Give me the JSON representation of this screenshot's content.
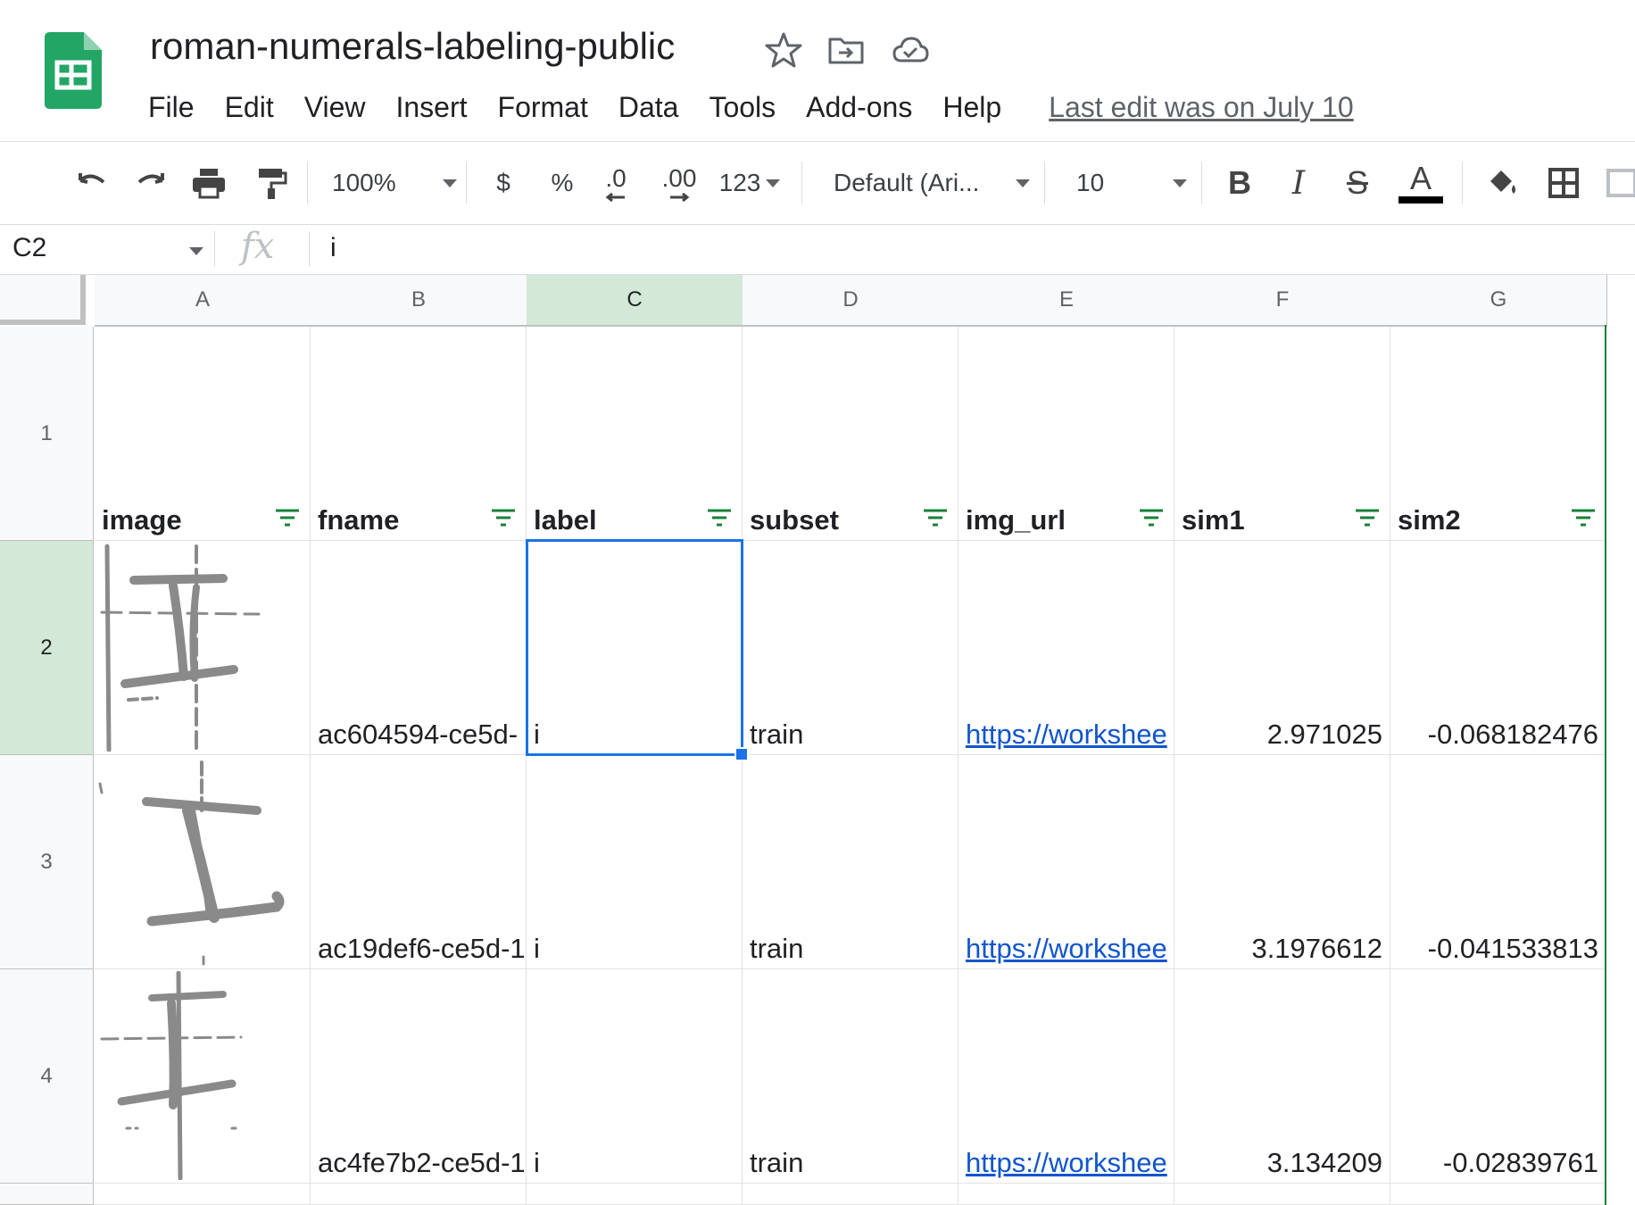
{
  "title_bar": {
    "doc_title": "roman-numerals-labeling-public",
    "last_edit": "Last edit was on July 10",
    "menu": [
      "File",
      "Edit",
      "View",
      "Insert",
      "Format",
      "Data",
      "Tools",
      "Add-ons",
      "Help"
    ],
    "icons": [
      "star-icon",
      "move-to-folder-icon",
      "cloud-saved-icon"
    ]
  },
  "toolbar": {
    "zoom": "100%",
    "currency": "$",
    "percent": "%",
    "decrease_decimal": ".0",
    "increase_decimal": ".00",
    "more_formats": "123",
    "font": "Default (Ari...",
    "font_size": "10",
    "bold": "B",
    "italic": "I",
    "strike": "S",
    "text_color": "A"
  },
  "formula_bar": {
    "cell_ref": "C2",
    "fx": "fx",
    "value": "i"
  },
  "grid": {
    "columns": [
      "A",
      "B",
      "C",
      "D",
      "E",
      "F",
      "G"
    ],
    "active_column": "C",
    "rows": [
      "1",
      "2",
      "3",
      "4"
    ],
    "active_row": "2",
    "header_row": [
      "image",
      "fname",
      "label",
      "subset",
      "img_url",
      "sim1",
      "sim2"
    ],
    "data_rows": [
      {
        "fname": "ac604594-ce5d-",
        "label": "i",
        "subset": "train",
        "img_url": "https://workshee",
        "sim1": "2.971025",
        "sim2": "-0.068182476"
      },
      {
        "fname": "ac19def6-ce5d-1",
        "label": "i",
        "subset": "train",
        "img_url": "https://workshee",
        "sim1": "3.1976612",
        "sim2": "-0.041533813"
      },
      {
        "fname": "ac4fe7b2-ce5d-1",
        "label": "i",
        "subset": "train",
        "img_url": "https://workshee",
        "sim1": "3.134209",
        "sim2": "-0.02839761"
      }
    ]
  },
  "colors": {
    "sheets_green": "#23a566",
    "selection_blue": "#1a73e8",
    "link_blue": "#1155cc",
    "active_header": "#d3e8d7"
  }
}
